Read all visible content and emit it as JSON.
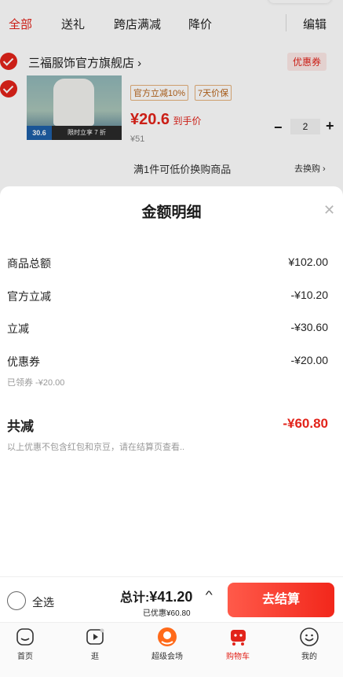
{
  "tabs": [
    "全部",
    "送礼",
    "跨店满减",
    "降价",
    "编辑"
  ],
  "shop": {
    "name": "三福服饰官方旗舰店 ›",
    "coupon_tag": "优惠券"
  },
  "product": {
    "img_price": "30.6",
    "img_text": "限时立享 7 折",
    "tags": [
      "官方立减10%",
      "7天价保"
    ],
    "price": "¥20.6",
    "price_suffix": "到手价",
    "original_price": "¥51",
    "quantity": "2"
  },
  "exchange": {
    "text": "满1件可低价换购商品",
    "link": "去换购 ›"
  },
  "sheet": {
    "title": "金额明细",
    "rows": [
      {
        "label": "商品总额",
        "value": "¥102.00"
      },
      {
        "label": "官方立减",
        "value": "-¥10.20"
      },
      {
        "label": "立减",
        "value": "-¥30.60"
      },
      {
        "label": "优惠券",
        "value": "-¥20.00"
      }
    ],
    "coupon_note": "已领券 -¥20.00",
    "total_label": "共减",
    "total_value": "-¥60.80",
    "disclaimer": "以上优惠不包含红包和京豆，请在结算页查看.."
  },
  "checkout": {
    "select_all": "全选",
    "total_prefix": "总计:",
    "total_amount": "¥41.20",
    "saved": "已优惠¥60.80",
    "button": "去结算"
  },
  "nav": [
    {
      "label": "首页",
      "icon": "home-icon"
    },
    {
      "label": "逛",
      "icon": "video-icon"
    },
    {
      "label": "超级会场",
      "icon": "super-venue-icon"
    },
    {
      "label": "购物车",
      "icon": "cart-icon"
    },
    {
      "label": "我的",
      "icon": "profile-icon"
    }
  ],
  "colors": {
    "accent": "#e2231a",
    "tag": "#b8641a"
  }
}
